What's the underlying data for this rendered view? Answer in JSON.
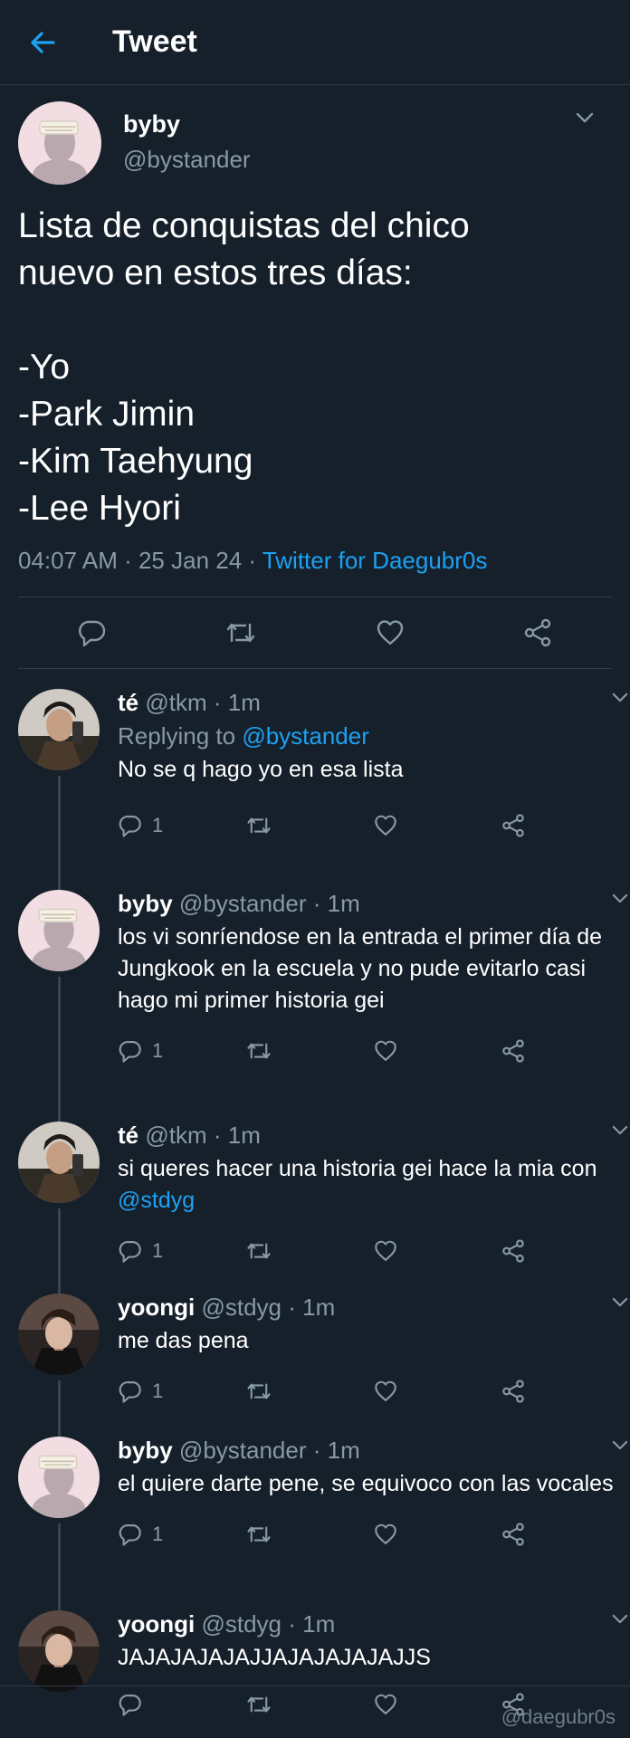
{
  "header": {
    "title": "Tweet"
  },
  "main_tweet": {
    "name": "byby",
    "handle": "@bystander",
    "lines": [
      "Lista de conquistas del chico",
      "nuevo en estos tres días:",
      "",
      "-Yo",
      "-Park Jimin",
      "-Kim Taehyung",
      "-Lee Hyori"
    ],
    "time": "04:07 AM",
    "date": "25 Jan 24",
    "source": "Twitter for Daegubr0s"
  },
  "replies": [
    {
      "name": "té",
      "handle": "@tkm",
      "time": "1m",
      "replying_label": "Replying to",
      "replying_to": "@bystander",
      "text": "No se q hago yo en esa lista",
      "reply_count": "1",
      "avatar": "tkm"
    },
    {
      "name": "byby",
      "handle": "@bystander",
      "time": "1m",
      "text": "los vi sonríendose en la entrada el primer día de Jungkook en la escuela y no pude evitarlo casi hago mi primer historia gei",
      "reply_count": "1",
      "avatar": "bystander"
    },
    {
      "name": "té",
      "handle": "@tkm",
      "time": "1m",
      "text": "si queres hacer una historia gei hace la mia con",
      "mention": "@stdyg",
      "reply_count": "1",
      "avatar": "tkm"
    },
    {
      "name": "yoongi",
      "handle": "@stdyg",
      "time": "1m",
      "text": "me das pena",
      "reply_count": "1",
      "avatar": "stdyg"
    },
    {
      "name": "byby",
      "handle": "@bystander",
      "time": "1m",
      "text": "el quiere darte pene, se equivoco con las vocales",
      "reply_count": "1",
      "avatar": "bystander"
    },
    {
      "name": "yoongi",
      "handle": "@stdyg",
      "time": "1m",
      "text": "JAJAJAJAJAJJAJAJAJAJAJJS",
      "reply_count": "",
      "avatar": "stdyg"
    }
  ],
  "watermark": "@daegubr0s",
  "colors": {
    "background": "#15202b",
    "accent": "#1da1f2",
    "secondary_text": "#8899a6",
    "divider": "#2f3b47"
  }
}
